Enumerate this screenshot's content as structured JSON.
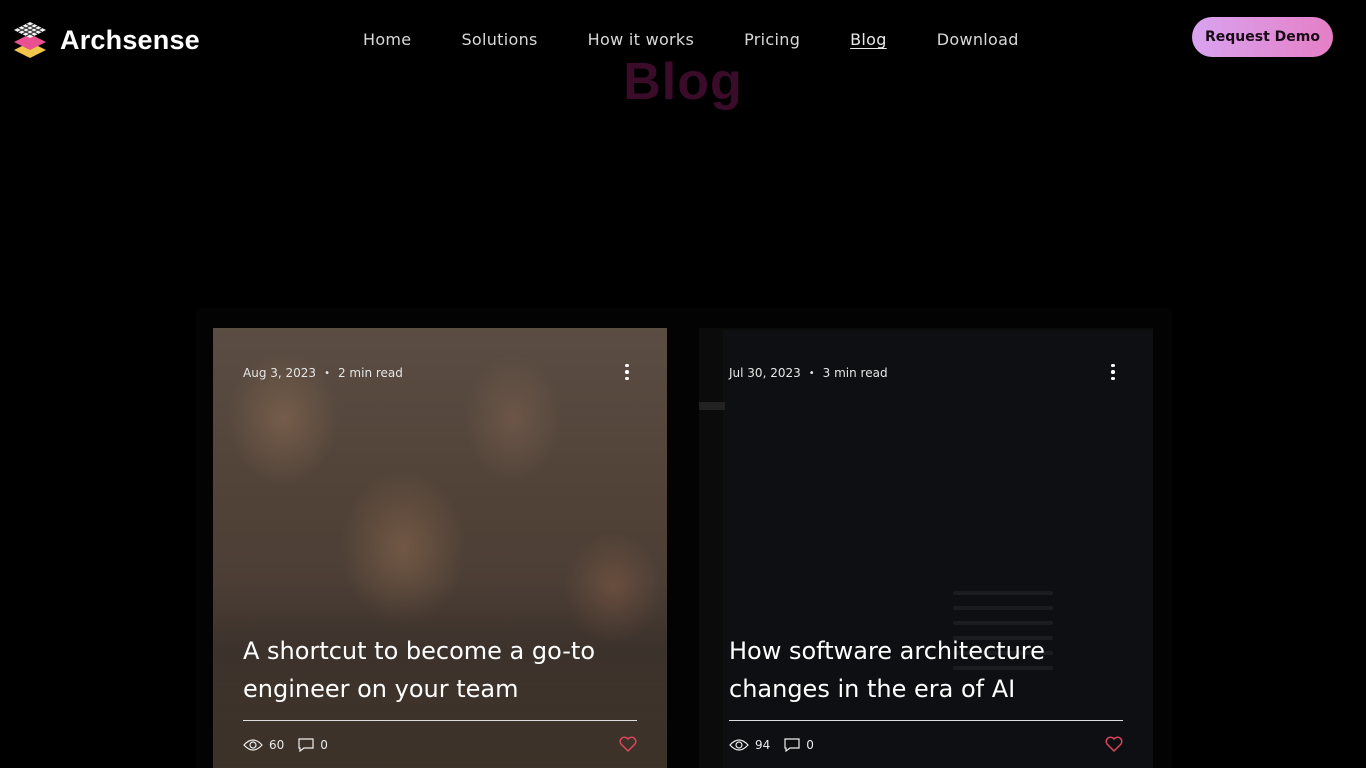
{
  "brand": {
    "name": "Archsense"
  },
  "nav": {
    "items": [
      {
        "label": "Home"
      },
      {
        "label": "Solutions"
      },
      {
        "label": "How it works"
      },
      {
        "label": "Pricing"
      },
      {
        "label": "Blog",
        "active": true
      },
      {
        "label": "Download"
      }
    ],
    "cta_label": "Request Demo"
  },
  "page": {
    "heading": "Blog"
  },
  "posts": [
    {
      "date": "Aug 3, 2023",
      "read_time": "2 min read",
      "title": "A shortcut to become a go-to engineer on your team",
      "views": "60",
      "comments": "0"
    },
    {
      "date": "Jul 30, 2023",
      "read_time": "3 min read",
      "title": "How software architecture changes in the era of AI",
      "views": "94",
      "comments": "0"
    }
  ],
  "colors": {
    "accent_heart": "#e2475f",
    "cta_start": "#d9a3f0",
    "cta_end": "#e57fc6",
    "heading": "#3a0c2a"
  }
}
